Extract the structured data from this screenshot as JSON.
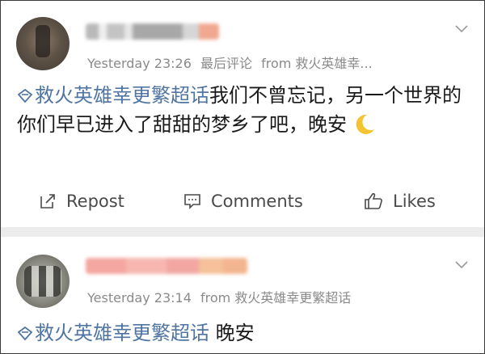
{
  "posts": [
    {
      "meta": {
        "time": "Yesterday 23:26",
        "extra": "最后评论",
        "source": "from 救火英雄幸..."
      },
      "topic": "救火英雄幸更繁超话",
      "text": "我们不曾忘记，另一个世界的你们早已进入了甜甜的梦乡了吧，晚安",
      "emoji": "crescent-moon"
    },
    {
      "meta": {
        "time": "Yesterday 23:14",
        "source": "from 救火英雄幸更繁超话"
      },
      "topic": "救火英雄幸更繁超话",
      "text": " 晚安"
    }
  ],
  "actions": {
    "repost": "Repost",
    "comments": "Comments",
    "likes": "Likes"
  },
  "colors": {
    "topic_link": "#5075a3",
    "meta": "#8a8a8a",
    "background": "#ececec"
  },
  "icons": [
    "chevron-down-icon",
    "topic-diamond-icon",
    "crescent-moon-icon",
    "repost-icon",
    "comment-icon",
    "like-icon"
  ]
}
